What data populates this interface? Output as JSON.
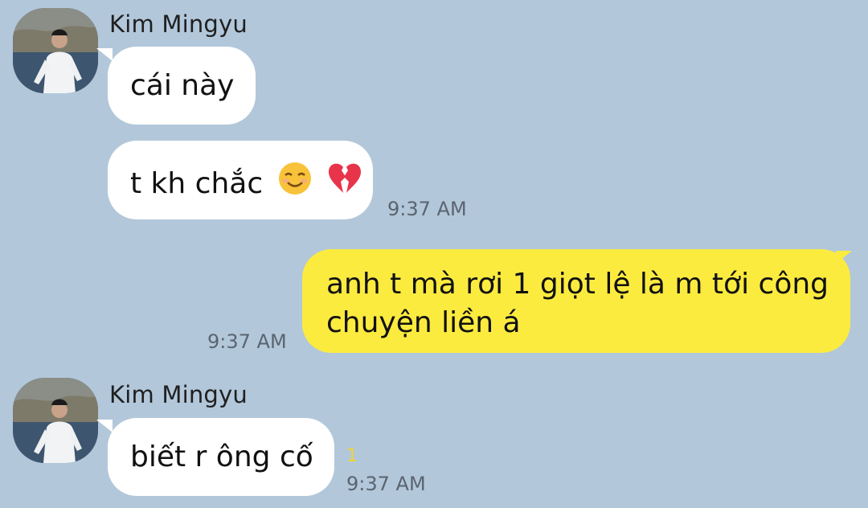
{
  "messages": [
    {
      "sender": "Kim Mingyu",
      "avatar_icon": "profile-photo-avatar",
      "bubbles": [
        {
          "text": "cái này",
          "time": ""
        },
        {
          "text": "t kh chắc",
          "emojis": [
            "smiling-face-icon",
            "broken-heart-icon"
          ],
          "time": "9:37 AM"
        }
      ]
    },
    {
      "sender": "me",
      "bubbles": [
        {
          "line1": "anh t mà rơi 1 giọt lệ là m tới công",
          "line2": "chuyện liền á",
          "time": "9:37 AM"
        }
      ]
    },
    {
      "sender": "Kim Mingyu",
      "avatar_icon": "profile-photo-avatar",
      "bubbles": [
        {
          "text": "biết r ông cố",
          "unread": "1",
          "time": "9:37 AM"
        }
      ]
    }
  ],
  "colors": {
    "background": "#b2c7da",
    "incoming_bubble": "#ffffff",
    "outgoing_bubble": "#fceb3f",
    "unread_count": "#f2d52b"
  }
}
